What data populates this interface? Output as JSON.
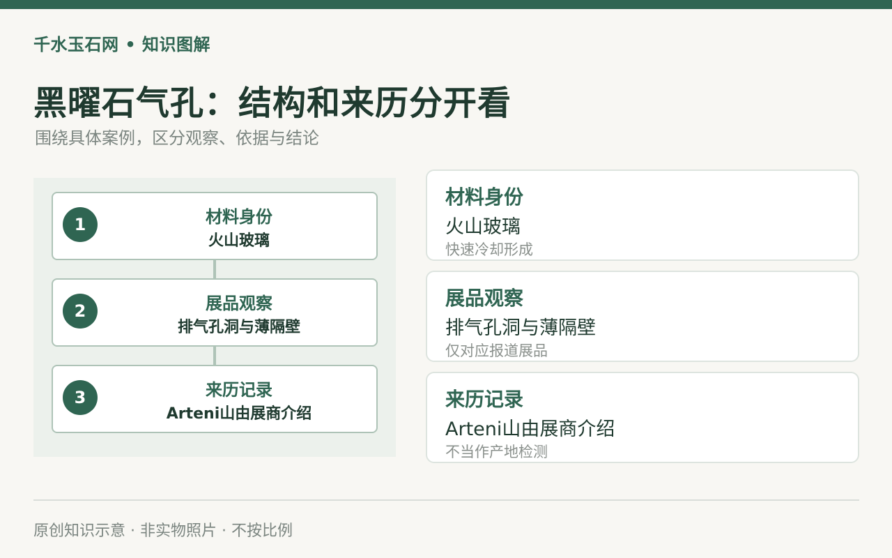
{
  "brand": "千水玉石网 • 知识图解",
  "title": "黑曜石气孔：结构和来历分开看",
  "subtitle": "围绕具体案例，区分观察、依据与结论",
  "steps": [
    {
      "num": "1",
      "label": "材料身份",
      "value": "火山玻璃"
    },
    {
      "num": "2",
      "label": "展品观察",
      "value": "排气孔洞与薄隔壁"
    },
    {
      "num": "3",
      "label": "来历记录",
      "value": "Arteni山由展商介绍"
    }
  ],
  "cards": [
    {
      "title": "材料身份",
      "value": "火山玻璃",
      "note": "快速冷却形成"
    },
    {
      "title": "展品观察",
      "value": "排气孔洞与薄隔壁",
      "note": "仅对应报道展品"
    },
    {
      "title": "来历记录",
      "value": "Arteni山由展商介绍",
      "note": "不当作产地检测"
    }
  ],
  "footer": "原创知识示意 · 非实物照片 · 不按比例",
  "colors": {
    "accent": "#2f6552",
    "panel": "#ecf1ec",
    "background": "#f8f7f3"
  }
}
